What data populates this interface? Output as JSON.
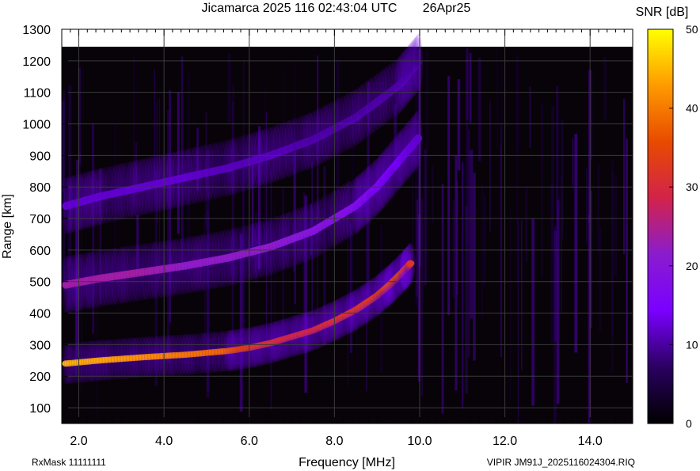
{
  "title": "Jicamarca 2025 116 02:43:04 UTC",
  "date": "26Apr25",
  "footer_left": "RxMask 11111111",
  "footer_right": "VIPIR  JM91J_2025116024304.RIQ",
  "chart_data": {
    "type": "heatmap",
    "title": "Jicamarca 2025 116 02:43:04 UTC",
    "xlabel": "Frequency [MHz]",
    "ylabel": "Range [km]",
    "xlim": [
      1.6,
      15.0
    ],
    "ylim": [
      50,
      1300
    ],
    "x_ticks": [
      2.0,
      4.0,
      6.0,
      8.0,
      10.0,
      12.0,
      14.0
    ],
    "x_tick_labels": [
      "2.0",
      "4.0",
      "6.0",
      "8.0",
      "10.0",
      "12.0",
      "14.0"
    ],
    "y_ticks": [
      100,
      200,
      300,
      400,
      500,
      600,
      700,
      800,
      900,
      1000,
      1100,
      1200,
      1300
    ],
    "y_tick_labels": [
      "100",
      "200",
      "300",
      "400",
      "500",
      "600",
      "700",
      "800",
      "900",
      "1000",
      "1100",
      "1200",
      "1300"
    ],
    "grid": true,
    "data_range_km": [
      50,
      1245
    ],
    "colorbar": {
      "label": "SNR [dB]",
      "range": [
        0,
        50
      ],
      "ticks": [
        0,
        10,
        20,
        30,
        40,
        50
      ],
      "tick_labels": [
        "0",
        "10",
        "20",
        "30",
        "40",
        "50"
      ],
      "colors": [
        "#000000",
        "#2a0060",
        "#7a00ff",
        "#8a1ccf",
        "#d2234a",
        "#e84a00",
        "#ff9a00",
        "#ffff00"
      ]
    },
    "traces": [
      {
        "name": "",
        "x": [
          1.7,
          2.5,
          3.5,
          4.5,
          5.5,
          6.0,
          6.5,
          7.0,
          7.5,
          8.0,
          8.5,
          9.0,
          9.3,
          9.6,
          9.8
        ],
        "y": [
          240,
          250,
          260,
          268,
          280,
          290,
          305,
          325,
          345,
          375,
          410,
          455,
          490,
          530,
          560
        ],
        "snr": [
          45,
          44,
          42,
          40,
          38,
          34,
          32,
          30,
          30,
          32,
          33,
          34,
          36,
          36,
          32
        ]
      },
      {
        "name": "",
        "x": [
          1.7,
          2.5,
          3.5,
          4.5,
          5.5,
          6.5,
          7.5,
          8.5,
          9.0,
          9.5,
          10.0
        ],
        "y": [
          490,
          510,
          530,
          550,
          575,
          610,
          660,
          740,
          800,
          880,
          960
        ],
        "snr": [
          24,
          24,
          24,
          22,
          22,
          22,
          20,
          18,
          16,
          14,
          12
        ]
      },
      {
        "name": "",
        "x": [
          1.7,
          2.5,
          3.5,
          4.5,
          5.5,
          6.5,
          7.5,
          8.5,
          9.5,
          10.0
        ],
        "y": [
          740,
          770,
          800,
          830,
          860,
          900,
          950,
          1020,
          1120,
          1200
        ],
        "snr": [
          12,
          12,
          12,
          12,
          11,
          11,
          10,
          10,
          10,
          9
        ]
      }
    ]
  }
}
